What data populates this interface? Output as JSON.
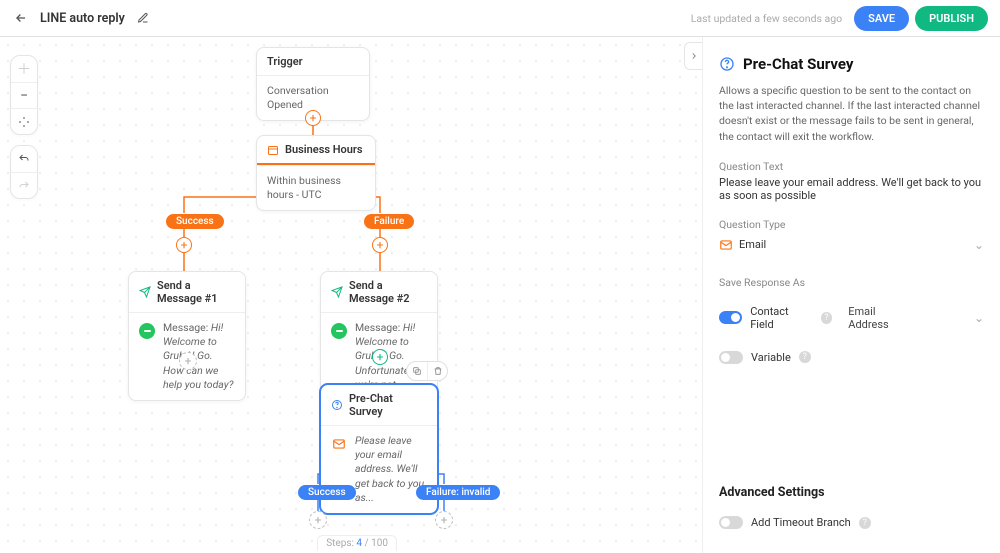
{
  "header": {
    "title": "LINE auto reply",
    "updated": "Last updated a few seconds ago",
    "save": "SAVE",
    "publish": "PUBLISH"
  },
  "canvas": {
    "trigger": {
      "title": "Trigger",
      "sub": "Conversation Opened"
    },
    "biz": {
      "title": "Business Hours",
      "sub": "Within business hours - UTC"
    },
    "pills": {
      "success": "Success",
      "failure": "Failure",
      "success2": "Success",
      "failinvalid": "Failure: invalid"
    },
    "msg1": {
      "title": "Send a Message #1",
      "prefix": "Message: ",
      "body": "Hi! Welcome to Grub N Go. How can we help you today?"
    },
    "msg2": {
      "title": "Send a Message #2",
      "prefix": "Message: ",
      "body": "Hi! Welcome to Grub N Go. Unfortunately we're not..."
    },
    "prechat": {
      "title": "Pre-Chat Survey",
      "body": "Please leave your email address. We'll get back to you as..."
    }
  },
  "footer": {
    "prefix": "Steps: ",
    "cur": "4",
    "sep": " / ",
    "max": "100"
  },
  "panel": {
    "title": "Pre-Chat Survey",
    "desc": "Allows a specific question to be sent to the contact on the last interacted channel. If the last interacted channel doesn't exist or the message fails to be sent in general, the contact will exit the workflow.",
    "qtext_label": "Question Text",
    "qtext": "Please leave your email address. We'll get back to you as soon as possible",
    "qtype_label": "Question Type",
    "qtype": "Email",
    "save_as": "Save Response As",
    "contact_field": "Contact Field",
    "cf_val": "Email Address",
    "variable": "Variable",
    "advanced": "Advanced Settings",
    "timeout": "Add Timeout Branch"
  }
}
